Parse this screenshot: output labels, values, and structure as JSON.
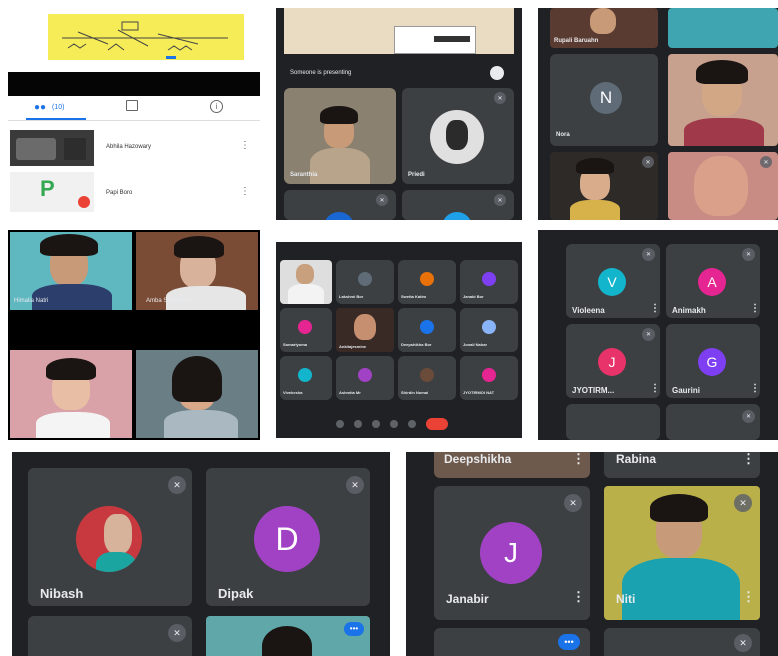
{
  "panel1": {
    "tab_people_count": "(10)",
    "people": [
      {
        "name": "Abhila Hazowary"
      },
      {
        "name": "Papi Boro",
        "avatar_letter": "P"
      }
    ]
  },
  "panel2": {
    "presenting_text": "Someone is presenting",
    "tiles": [
      {
        "name": "Saranthia"
      },
      {
        "name": "Priedi"
      }
    ]
  },
  "panel3": {
    "tiles": [
      {
        "name": "Rupali Baruahn"
      },
      {
        "name": "Nora",
        "avatar_letter": "N"
      }
    ]
  },
  "panel4": {
    "tiles": [
      {
        "name": "Himalia Natri"
      },
      {
        "name": "Amba Swargiary"
      }
    ]
  },
  "panel5": {
    "tiles": [
      {
        "name": "Swranti"
      },
      {
        "name": "Lakshmi Bor"
      },
      {
        "name": "Swetta Katim"
      },
      {
        "name": "Janabi Bor"
      },
      {
        "name": "Somariyoma"
      },
      {
        "name": "Ankitajesmine"
      },
      {
        "name": "Deepshikha Bor"
      },
      {
        "name": "Jonali Nahar"
      },
      {
        "name": "Vivekesha"
      },
      {
        "name": "Ashmita Mr"
      },
      {
        "name": "Shirdin Nomai"
      },
      {
        "name": "JYOTIRMOI NAT"
      }
    ]
  },
  "panel6": {
    "tiles": [
      {
        "name": "Violeena",
        "avatar_letter": "V",
        "color": "#12b5cb"
      },
      {
        "name": "Animakh",
        "avatar_letter": "A",
        "color": "#e52592"
      },
      {
        "name": "JYOTIRM...",
        "avatar_letter": "J",
        "color": "#e8336a"
      },
      {
        "name": "Gaurini",
        "avatar_letter": "G",
        "color": "#7e3ff2"
      }
    ]
  },
  "panel7": {
    "tiles": [
      {
        "name": "Nibash"
      },
      {
        "name": "Dipak",
        "avatar_letter": "D",
        "color": "#a142c4"
      }
    ]
  },
  "panel8": {
    "tiles": [
      {
        "name": "Deepshikha"
      },
      {
        "name": "Rabina"
      },
      {
        "name": "Janabir",
        "avatar_letter": "J",
        "color": "#a142c4"
      },
      {
        "name": "Niti"
      }
    ]
  },
  "colors": {
    "meet_bg": "#202124",
    "tile_bg": "#3c4043",
    "end_call": "#ea4335",
    "accent": "#1a73e8"
  },
  "icons": [
    "people-icon",
    "chat-icon",
    "info-icon",
    "mic-off-icon",
    "more-vert-icon",
    "end-call-icon"
  ]
}
